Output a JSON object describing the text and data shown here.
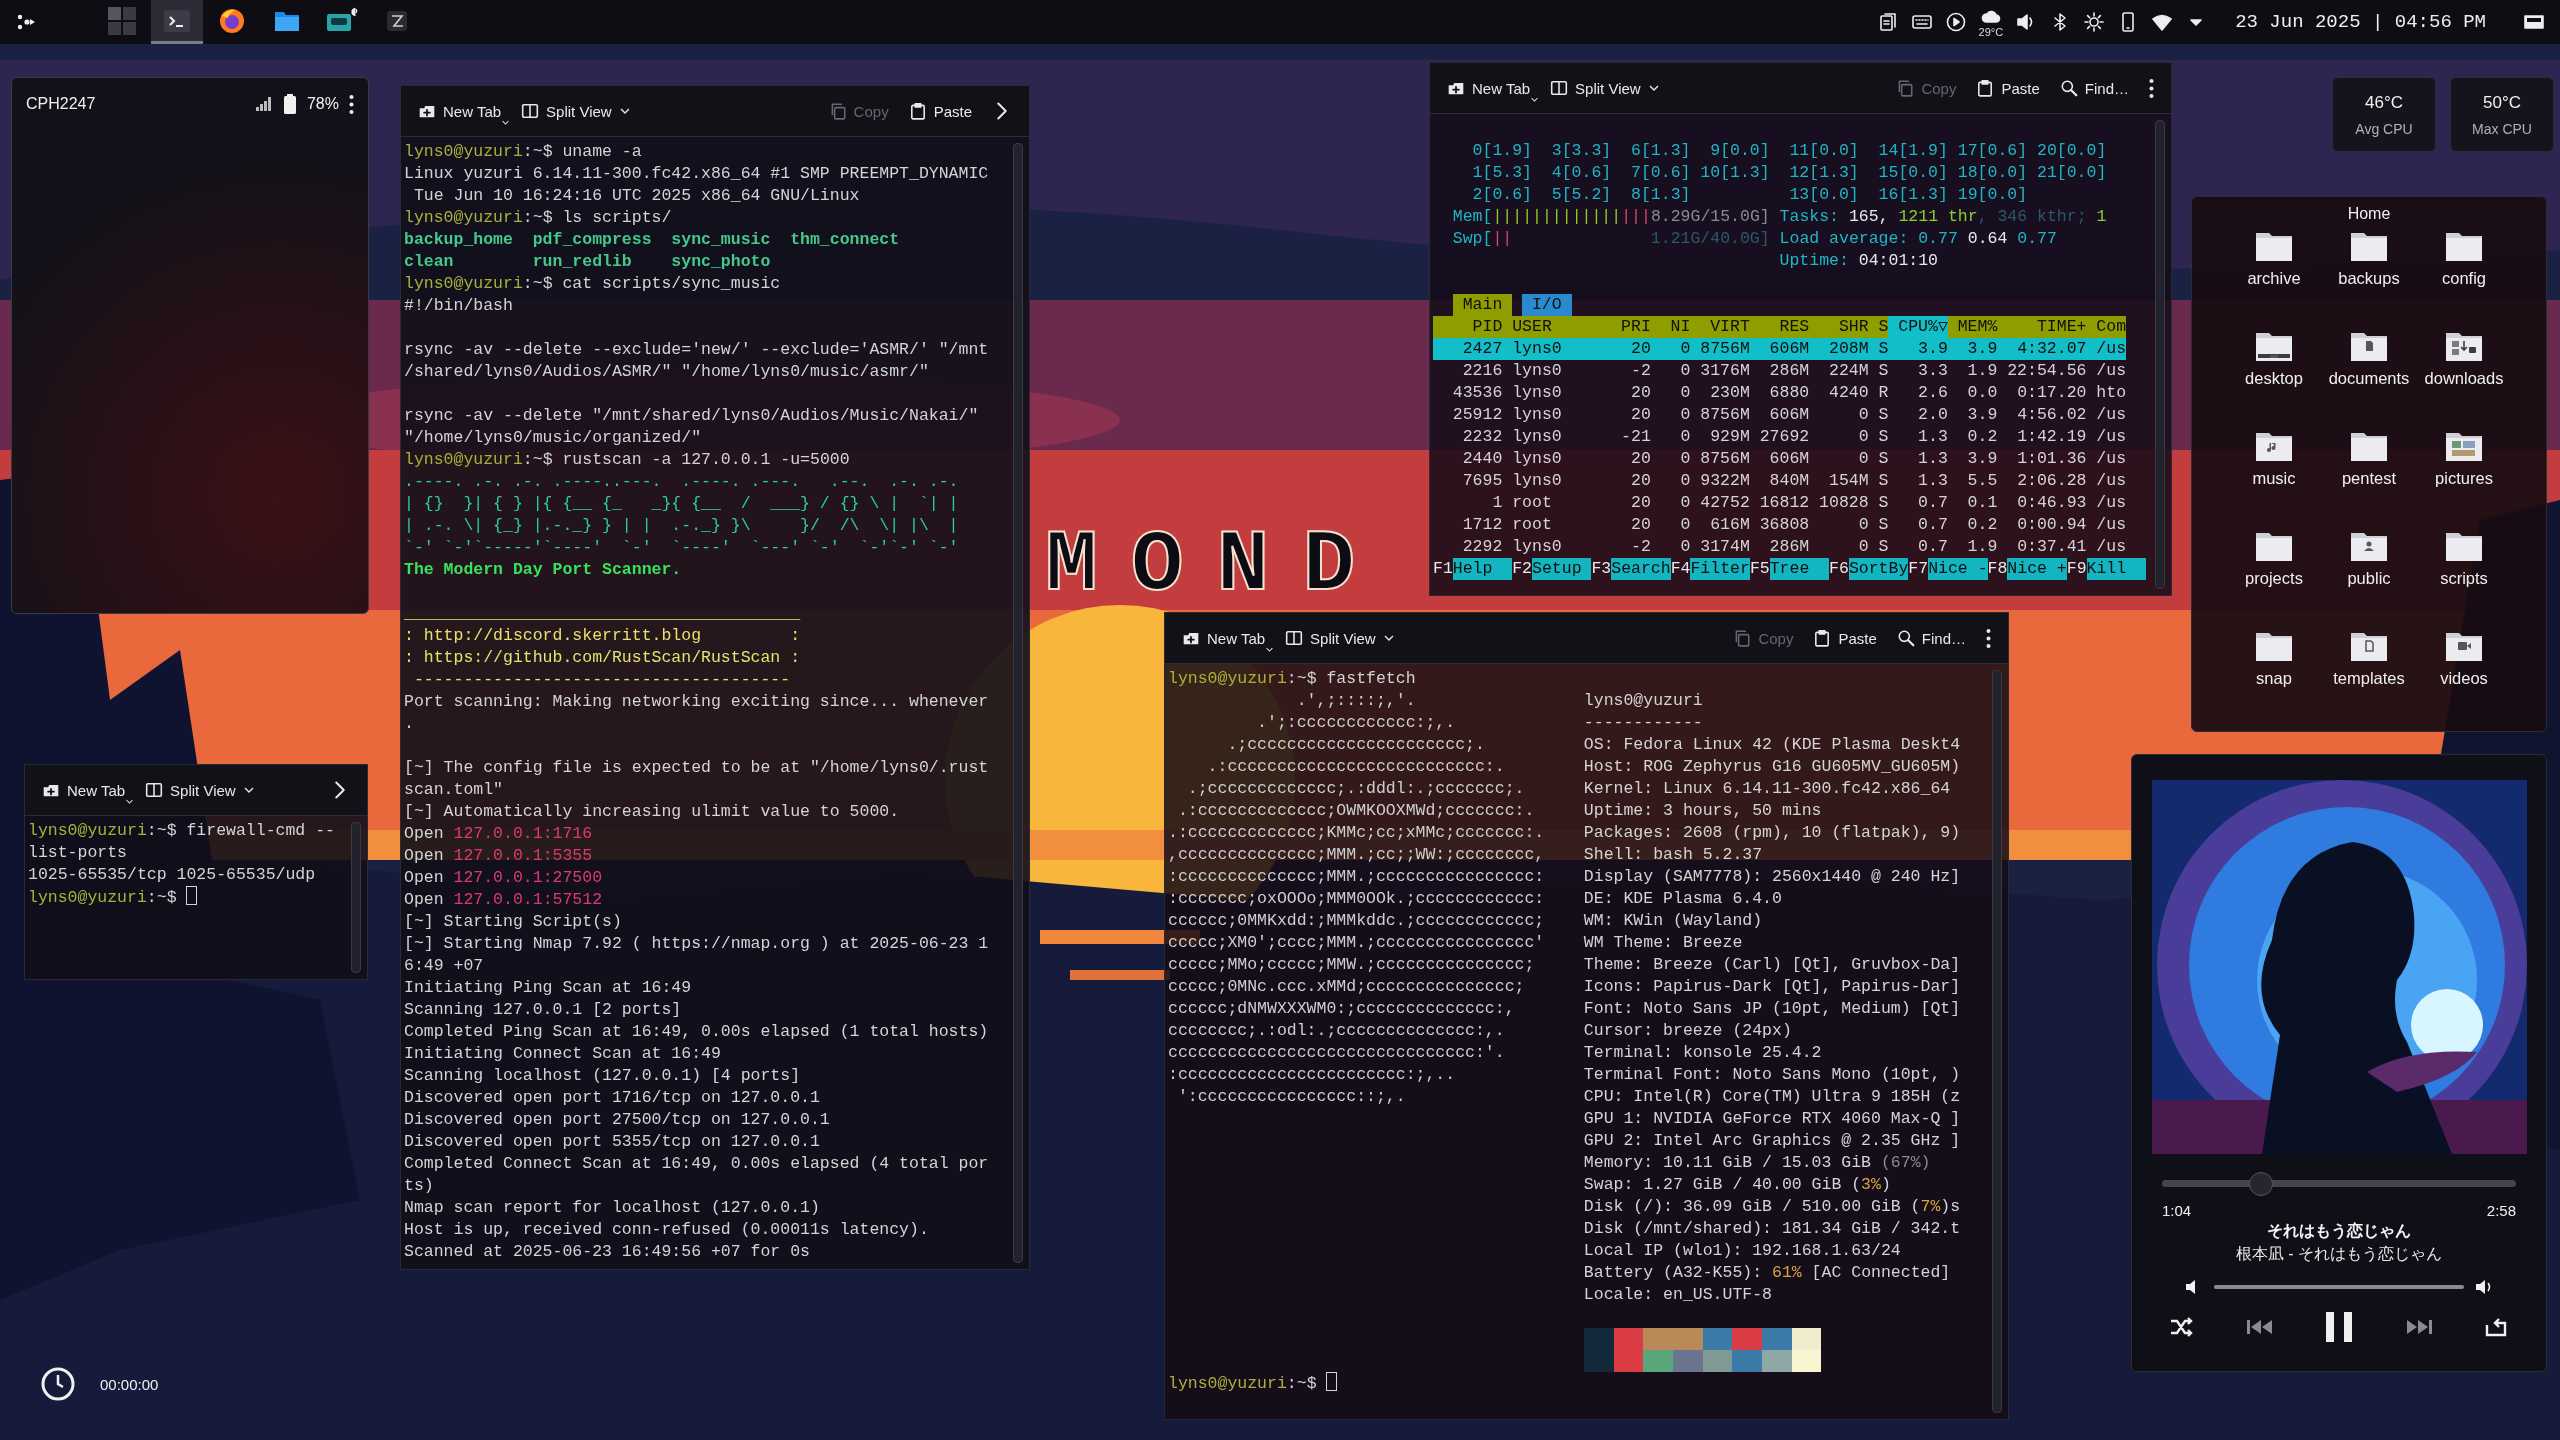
{
  "taskbar": {
    "tasks": [
      {
        "kind": "pager",
        "selected": false
      },
      {
        "kind": "terminal",
        "selected": true
      },
      {
        "kind": "browser",
        "selected": false
      },
      {
        "kind": "files",
        "selected": false
      },
      {
        "kind": "media",
        "selected": false
      },
      {
        "kind": "editor",
        "selected": false
      }
    ],
    "weather": "29°C",
    "clock": "23 Jun 2025 | 04:56 PM"
  },
  "phone": {
    "device": "CPH2247",
    "battery": "78%"
  },
  "day_widget": {
    "text": "MOND"
  },
  "stopwatch": {
    "time": "00:00:00"
  },
  "port_scan_terminal": {
    "toolbar": [
      {
        "kind": "new-tab",
        "label": "New Tab"
      },
      {
        "kind": "split",
        "label": "Split View"
      },
      {
        "kind": "copy",
        "label": "Copy",
        "disabled": true
      },
      {
        "kind": "paste",
        "label": "Paste"
      },
      {
        "kind": "overflow"
      }
    ],
    "lines": [
      [
        {
          "text": "lyns0@yuzuri",
          "kind": "prompt"
        },
        {
          "text": ":~$ uname -a",
          "kind": "plain"
        }
      ],
      "Linux yuzuri 6.14.11-300.fc42.x86_64 #1 SMP PREEMPT_DYNAMIC",
      " Tue Jun 10 16:24:16 UTC 2025 x86_64 GNU/Linux",
      [
        {
          "text": "lyns0@yuzuri",
          "kind": "prompt"
        },
        {
          "text": ":~$ ls scripts/",
          "kind": "plain"
        }
      ],
      [
        {
          "text": "backup_home  pdf_compress  sync_music  thm_connect",
          "kind": "dir"
        }
      ],
      [
        {
          "text": "clean        run_redlib    sync_photo",
          "kind": "dir"
        }
      ],
      [
        {
          "text": "lyns0@yuzuri",
          "kind": "prompt"
        },
        {
          "text": ":~$ cat scripts/sync_music",
          "kind": "plain"
        }
      ],
      "#!/bin/bash",
      {
        "kind": "blank"
      },
      "rsync -av --delete --exclude='new/' --exclude='ASMR/' \"/mnt",
      "/shared/lyns0/Audios/ASMR/\" \"/home/lyns0/music/asmr/\"",
      {
        "kind": "blank"
      },
      "rsync -av --delete \"/mnt/shared/lyns0/Audios/Music/Nakai/\"",
      "\"/home/lyns0/music/organized/\"",
      [
        {
          "text": "lyns0@yuzuri",
          "kind": "prompt"
        },
        {
          "text": ":~$ rustscan -a 127.0.0.1 -u=5000",
          "kind": "plain"
        }
      ],
      [
        {
          "text": ".----. .-. .-. .----..---.  .----. .---.   .--.  .-. .-.",
          "kind": "banner"
        }
      ],
      [
        {
          "text": "| {}  }| { } |{ {__ {_   _}{ {__  /  ___} / {} \\ |  `| |",
          "kind": "banner"
        }
      ],
      [
        {
          "text": "| .-. \\| {_} |.-._} } | |  .-._} }\\     }/  /\\  \\| |\\  |",
          "kind": "banner"
        }
      ],
      [
        {
          "text": "`-' `-'`-----'`----'  `-'  `----'  `---' `-'  `-'`-' `-'",
          "kind": "banner"
        }
      ],
      [
        {
          "text": "The Modern Day Port Scanner.",
          "kind": "title"
        }
      ],
      {
        "kind": "blank"
      },
      [
        {
          "text": "________________________________________",
          "kind": "yellow"
        }
      ],
      [
        {
          "text": ": http://discord.skerritt.blog         :",
          "kind": "yellow"
        }
      ],
      [
        {
          "text": ": https://github.com/RustScan/RustScan :",
          "kind": "yellow"
        }
      ],
      [
        {
          "text": " --------------------------------------",
          "kind": "yellow"
        }
      ],
      "Port scanning: Making networking exciting since... whenever",
      ".",
      {
        "kind": "blank"
      },
      "[~] The config file is expected to be at \"/home/lyns0/.rust",
      "scan.toml\"",
      "[~] Automatically increasing ulimit value to 5000.",
      [
        {
          "text": "Open ",
          "kind": "plain"
        },
        {
          "text": "127.0.0.1:1716",
          "kind": "ip"
        }
      ],
      [
        {
          "text": "Open ",
          "kind": "plain"
        },
        {
          "text": "127.0.0.1:5355",
          "kind": "ip"
        }
      ],
      [
        {
          "text": "Open ",
          "kind": "plain"
        },
        {
          "text": "127.0.0.1:27500",
          "kind": "ip"
        }
      ],
      [
        {
          "text": "Open ",
          "kind": "plain"
        },
        {
          "text": "127.0.0.1:57512",
          "kind": "ip"
        }
      ],
      "[~] Starting Script(s)",
      "[~] Starting Nmap 7.92 ( https://nmap.org ) at 2025-06-23 1",
      "6:49 +07",
      "Initiating Ping Scan at 16:49",
      "Scanning 127.0.0.1 [2 ports]",
      "Completed Ping Scan at 16:49, 0.00s elapsed (1 total hosts)",
      "Initiating Connect Scan at 16:49",
      "Scanning localhost (127.0.0.1) [4 ports]",
      "Discovered open port 1716/tcp on 127.0.0.1",
      "Discovered open port 27500/tcp on 127.0.0.1",
      "Discovered open port 5355/tcp on 127.0.0.1",
      "Completed Connect Scan at 16:49, 0.00s elapsed (4 total por",
      "ts)",
      "Nmap scan report for localhost (127.0.0.1)",
      "Host is up, received conn-refused (0.00011s latency).",
      "Scanned at 2025-06-23 16:49:56 +07 for 0s"
    ]
  },
  "firewall_terminal": {
    "toolbar": [
      {
        "kind": "new-tab",
        "label": "New Tab"
      },
      {
        "kind": "split",
        "label": "Split View"
      },
      {
        "kind": "overflow"
      }
    ],
    "lines": [
      [
        {
          "text": "lyns0@yuzuri",
          "kind": "prompt"
        },
        {
          "text": ":~$ firewall-cmd --",
          "kind": "plain"
        }
      ],
      "list-ports",
      "1025-65535/tcp 1025-65535/udp",
      [
        {
          "text": "lyns0@yuzuri",
          "kind": "prompt"
        },
        {
          "text": ":~$ ",
          "kind": "plain"
        },
        {
          "kind": "cursor"
        }
      ]
    ]
  },
  "htop_terminal": {
    "toolbar": [
      {
        "kind": "new-tab",
        "label": "New Tab"
      },
      {
        "kind": "split",
        "label": "Split View"
      },
      {
        "kind": "copy",
        "label": "Copy",
        "disabled": true
      },
      {
        "kind": "paste",
        "label": "Paste"
      },
      {
        "kind": "find",
        "label": "Find…"
      },
      {
        "kind": "more"
      }
    ],
    "meters": [
      {
        "kind": "blank"
      },
      [
        {
          "text": "    0[1.9]  3[3.3]  6[1.3]  9[0.0]  11[0.0]  14[1.9] 17[0.6] 20[0.0]",
          "kind": "cyan"
        }
      ],
      [
        {
          "text": "    1[5.3]  4[0.6]  7[0.6] 10[1.3]  12[1.3]  15[0.0] 18[0.0] 21[0.0]",
          "kind": "cyan"
        }
      ],
      [
        {
          "text": "    2[0.6]  5[5.2]  8[1.3]          13[0.0]  16[1.3] 19[0.0]",
          "kind": "cyan"
        }
      ],
      [
        {
          "text": "  Mem[",
          "kind": "cyan"
        },
        {
          "text": "|||||||||||||",
          "kind": "green"
        },
        {
          "text": "|||",
          "kind": "red"
        },
        {
          "text": "8.29G/15.0G]",
          "kind": "grey"
        },
        {
          "text": " Tasks: ",
          "kind": "cyan"
        },
        {
          "text": "165, ",
          "kind": "white"
        },
        {
          "text": "1211 thr",
          "kind": "green"
        },
        {
          "text": ", 346 kthr; ",
          "kind": "dim"
        },
        {
          "text": "1",
          "kind": "green"
        }
      ],
      [
        {
          "text": "  Swp[",
          "kind": "cyan"
        },
        {
          "text": "||",
          "kind": "red"
        },
        {
          "text": "              1.21G/40.0G]",
          "kind": "dim"
        },
        {
          "text": " Load average: 0.77 ",
          "kind": "cyan"
        },
        {
          "text": "0.64 ",
          "kind": "white"
        },
        {
          "text": "0.77",
          "kind": "cyan"
        }
      ],
      [
        {
          "text": "                                   Uptime: ",
          "kind": "cyan"
        },
        {
          "text": "04:01:10",
          "kind": "white"
        }
      ],
      {
        "kind": "blank"
      }
    ],
    "tabs": [
      {
        "label": "Main",
        "selected": true
      },
      {
        "label": "I/O",
        "selected": false
      }
    ],
    "columns": [
      {
        "label": "PID",
        "sorted": false
      },
      {
        "label": "USER",
        "sorted": false
      },
      {
        "label": "PRI",
        "sorted": false
      },
      {
        "label": "NI",
        "sorted": false
      },
      {
        "label": "VIRT",
        "sorted": false
      },
      {
        "label": "RES",
        "sorted": false
      },
      {
        "label": "SHR",
        "sorted": false
      },
      {
        "label": "S",
        "sorted": false
      },
      {
        "label": "CPU%▽",
        "sorted": true
      },
      {
        "label": "MEM%",
        "sorted": false
      },
      {
        "label": "TIME+",
        "sorted": false
      },
      {
        "label": "Com",
        "sorted": false
      }
    ],
    "processes": [
      {
        "selected": true,
        "cells": [
          "2427",
          "lyns0",
          "20",
          "0",
          "8756M",
          "606M",
          "208M",
          "S",
          "3.9",
          "3.9",
          "4:32.07",
          "/us"
        ]
      },
      {
        "selected": false,
        "cells": [
          "2216",
          "lyns0",
          "-2",
          "0",
          "3176M",
          "286M",
          "224M",
          "S",
          "3.3",
          "1.9",
          "22:54.56",
          "/us"
        ]
      },
      {
        "selected": false,
        "cells": [
          "43536",
          "lyns0",
          "20",
          "0",
          "230M",
          "6880",
          "4240",
          "R",
          "2.6",
          "0.0",
          "0:17.20",
          "hto"
        ]
      },
      {
        "selected": false,
        "cells": [
          "25912",
          "lyns0",
          "20",
          "0",
          "8756M",
          "606M",
          "0",
          "S",
          "2.0",
          "3.9",
          "4:56.02",
          "/us"
        ]
      },
      {
        "selected": false,
        "cells": [
          "2232",
          "lyns0",
          "-21",
          "0",
          "929M",
          "27692",
          "0",
          "S",
          "1.3",
          "0.2",
          "1:42.19",
          "/us"
        ]
      },
      {
        "selected": false,
        "cells": [
          "2440",
          "lyns0",
          "20",
          "0",
          "8756M",
          "606M",
          "0",
          "S",
          "1.3",
          "3.9",
          "1:01.36",
          "/us"
        ]
      },
      {
        "selected": false,
        "cells": [
          "7695",
          "lyns0",
          "20",
          "0",
          "9322M",
          "840M",
          "154M",
          "S",
          "1.3",
          "5.5",
          "2:06.28",
          "/us"
        ]
      },
      {
        "selected": false,
        "cells": [
          "1",
          "root",
          "20",
          "0",
          "42752",
          "16812",
          "10828",
          "S",
          "0.7",
          "0.1",
          "0:46.93",
          "/us"
        ]
      },
      {
        "selected": false,
        "cells": [
          "1712",
          "root",
          "20",
          "0",
          "616M",
          "36808",
          "0",
          "S",
          "0.7",
          "0.2",
          "0:00.94",
          "/us"
        ]
      },
      {
        "selected": false,
        "cells": [
          "2292",
          "lyns0",
          "-2",
          "0",
          "3174M",
          "286M",
          "0",
          "S",
          "0.7",
          "1.9",
          "0:37.41",
          "/us"
        ]
      }
    ],
    "function_keys": [
      {
        "key": "F1",
        "label": "Help"
      },
      {
        "key": "F2",
        "label": "Setup"
      },
      {
        "key": "F3",
        "label": "Search"
      },
      {
        "key": "F4",
        "label": "Filter"
      },
      {
        "key": "F5",
        "label": "Tree"
      },
      {
        "key": "F6",
        "label": "SortBy"
      },
      {
        "key": "F7",
        "label": "Nice -"
      },
      {
        "key": "F8",
        "label": "Nice +"
      },
      {
        "key": "F9",
        "label": "Kill"
      }
    ]
  },
  "fastfetch_terminal": {
    "toolbar": [
      {
        "kind": "new-tab",
        "label": "New Tab"
      },
      {
        "kind": "split",
        "label": "Split View"
      },
      {
        "kind": "copy",
        "label": "Copy",
        "disabled": true
      },
      {
        "kind": "paste",
        "label": "Paste"
      },
      {
        "kind": "find",
        "label": "Find…"
      },
      {
        "kind": "more"
      }
    ],
    "command_line": [
      {
        "text": "lyns0@yuzuri",
        "kind": "prompt"
      },
      {
        "text": ":~$ fastfetch",
        "kind": "plain"
      }
    ],
    "logo": [
      "             .',;::::;,'.",
      "         .';:cccccccccccc:;,.",
      "      .;cccccccccccccccccccccc;.",
      "    .:cccccccccccccccccccccccccc:.",
      "  .;ccccccccccccc;.:dddl:.;ccccccc;.",
      " .:ccccccccccccc;OWMKOOXMWd;ccccccc:.",
      ".:ccccccccccccc;KMMc;cc;xMMc;ccccccc:.",
      ",cccccccccccccc;MMM.;cc;;WW:;cccccccc,",
      ":cccccccccccccc;MMM.;cccccccccccccccc:",
      ":ccccccc;oxOOOo;MMM0OOk.;cccccccccccc:",
      "cccccc;0MMKxdd:;MMMkddc.;cccccccccccc;",
      "ccccc;XM0';cccc;MMM.;cccccccccccccccc'",
      "ccccc;MMo;ccccc;MMW.;ccccccccccccccc;",
      "ccccc;0MNc.ccc.xMMd;ccccccccccccccc;",
      "cccccc;dNMWXXXWM0:;cccccccccccccc:,",
      "cccccccc;.:odl:.;cccccccccccccc:,.",
      "ccccccccccccccccccccccccccccccc:'.",
      ":ccccccccccccccccccccccc:;,..",
      " ':cccccccccccccccc::;,."
    ],
    "info": [
      "lyns0@yuzuri",
      "------------",
      "OS: Fedora Linux 42 (KDE Plasma Deskt4",
      "Host: ROG Zephyrus G16 GU605MV_GU605M)",
      "Kernel: Linux 6.14.11-300.fc42.x86_64",
      "Uptime: 3 hours, 50 mins",
      "Packages: 2608 (rpm), 10 (flatpak), 9)",
      "Shell: bash 5.2.37",
      "Display (SAM7778): 2560x1440 @ 240 Hz]",
      "DE: KDE Plasma 6.4.0",
      "WM: KWin (Wayland)",
      "WM Theme: Breeze",
      "Theme: Breeze (Carl) [Qt], Gruvbox-Da]",
      "Icons: Papirus-Dark [Qt], Papirus-Dar]",
      "Font: Noto Sans JP (10pt, Medium) [Qt]",
      "Cursor: breeze (24px)",
      "Terminal: konsole 25.4.2",
      "Terminal Font: Noto Sans Mono (10pt, )",
      "CPU: Intel(R) Core(TM) Ultra 9 185H (z",
      "GPU 1: NVIDIA GeForce RTX 4060 Max-Q ]",
      "GPU 2: Intel Arc Graphics @ 2.35 GHz ]",
      [
        {
          "text": "Memory: 10.11 GiB / 15.03 GiB ",
          "kind": "plain"
        },
        {
          "text": "(67%)",
          "kind": "grey"
        }
      ],
      [
        {
          "text": "Swap: 1.27 GiB / 40.00 GiB (",
          "kind": "plain"
        },
        {
          "text": "3%",
          "kind": "amber"
        },
        {
          "text": ")",
          "kind": "plain"
        }
      ],
      [
        {
          "text": "Disk (/): 36.09 GiB / 510.00 GiB (",
          "kind": "plain"
        },
        {
          "text": "7%",
          "kind": "amber"
        },
        {
          "text": ")s",
          "kind": "plain"
        }
      ],
      "Disk (/mnt/shared): 181.34 GiB / 342.t",
      "Local IP (wlo1): 192.168.1.63/24",
      [
        {
          "text": "Battery (A32-K55): ",
          "kind": "plain"
        },
        {
          "text": "61%",
          "kind": "amber"
        },
        {
          "text": " [AC Connected]",
          "kind": "plain"
        }
      ],
      "Locale: en_US.UTF-8"
    ],
    "palette": [
      {
        "color": "#132a3a"
      },
      {
        "color": "#db3d45"
      },
      {
        "color": "#b98a57"
      },
      {
        "color": "#b98a57"
      },
      {
        "color": "#3b7ba8"
      },
      {
        "color": "#db3d45"
      },
      {
        "color": "#3b7ba8"
      },
      {
        "color": "#f2ecce"
      },
      {
        "color": "#132a3a"
      },
      {
        "color": "#db3d45"
      },
      {
        "color": "#5aa57a"
      },
      {
        "color": "#6b7590"
      },
      {
        "color": "#7f9a95"
      },
      {
        "color": "#3b7ba8"
      },
      {
        "color": "#8fa8a5"
      },
      {
        "color": "#f8f4d0"
      }
    ],
    "prompt_line": [
      {
        "text": "lyns0@yuzuri",
        "kind": "prompt"
      },
      {
        "text": ":~$ ",
        "kind": "plain"
      },
      {
        "kind": "cursor"
      }
    ]
  },
  "sensors": [
    {
      "value": "46°C",
      "label": "Avg CPU"
    },
    {
      "value": "50°C",
      "label": "Max CPU"
    }
  ],
  "home": {
    "title": "Home",
    "folders": [
      {
        "label": "archive",
        "kind": "plain"
      },
      {
        "label": "backups",
        "kind": "plain"
      },
      {
        "label": "config",
        "kind": "plain"
      },
      {
        "label": "desktop",
        "kind": "desktop"
      },
      {
        "label": "documents",
        "kind": "document"
      },
      {
        "label": "downloads",
        "kind": "download"
      },
      {
        "label": "music",
        "kind": "music"
      },
      {
        "label": "pentest",
        "kind": "plain"
      },
      {
        "label": "pictures",
        "kind": "picture"
      },
      {
        "label": "projects",
        "kind": "plain"
      },
      {
        "label": "public",
        "kind": "public"
      },
      {
        "label": "scripts",
        "kind": "plain"
      },
      {
        "label": "snap",
        "kind": "plain"
      },
      {
        "label": "templates",
        "kind": "template"
      },
      {
        "label": "videos",
        "kind": "video"
      }
    ]
  },
  "media": {
    "progress": {
      "level": 0.28
    },
    "elapsed": "1:04",
    "duration": "2:58",
    "title": "それはもう恋じゃん",
    "artist": "根本凪 - それはもう恋じゃん",
    "volume": {
      "level": 1
    }
  }
}
